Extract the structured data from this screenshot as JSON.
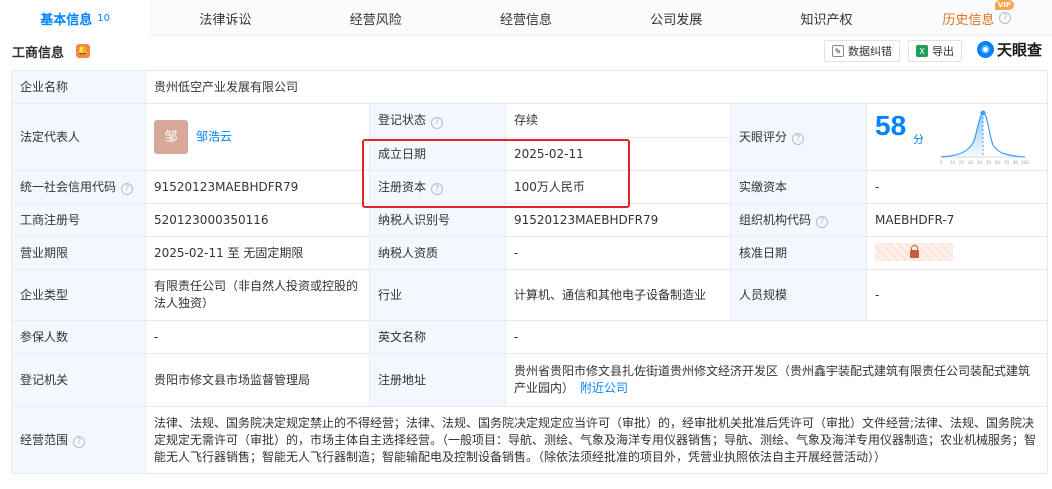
{
  "tabs": [
    {
      "label": "基本信息",
      "count": "10"
    },
    {
      "label": "法律诉讼"
    },
    {
      "label": "经营风险"
    },
    {
      "label": "经营信息"
    },
    {
      "label": "公司发展"
    },
    {
      "label": "知识产权"
    },
    {
      "label": "历史信息",
      "badge": "VIP"
    }
  ],
  "section": {
    "title": "工商信息",
    "correct_button": "数据纠错",
    "export_button": "导出",
    "brand": "天眼查"
  },
  "info": {
    "company_name_label": "企业名称",
    "company_name": "贵州低空产业发展有限公司",
    "legal_rep_label": "法定代表人",
    "legal_rep_avatar": "邹",
    "legal_rep": "邹浩云",
    "reg_status_label": "登记状态",
    "reg_status": "存续",
    "established_label": "成立日期",
    "established": "2025-02-11",
    "reg_capital_label": "注册资本",
    "reg_capital": "100万人民币",
    "score_label": "天眼评分",
    "score": "58",
    "score_unit": "分",
    "credit_code_label": "统一社会信用代码",
    "credit_code": "91520123MAEBHDFR79",
    "paidin_label": "实缴资本",
    "paidin": "-",
    "reg_no_label": "工商注册号",
    "reg_no": "520123000350116",
    "taxpayer_id_label": "纳税人识别号",
    "taxpayer_id": "91520123MAEBHDFR79",
    "org_code_label": "组织机构代码",
    "org_code": "MAEBHDFR-7",
    "term_label": "营业期限",
    "term": "2025-02-11 至 无固定期限",
    "taxpayer_qual_label": "纳税人资质",
    "taxpayer_qual": "-",
    "approval_date_label": "核准日期",
    "type_label": "企业类型",
    "type": "有限责任公司（非自然人投资或控股的法人独资）",
    "industry_label": "行业",
    "industry": "计算机、通信和其他电子设备制造业",
    "staff_label": "人员规模",
    "staff": "-",
    "insured_label": "参保人数",
    "insured": "-",
    "en_name_label": "英文名称",
    "en_name": "-",
    "authority_label": "登记机关",
    "authority": "贵阳市修文县市场监督管理局",
    "address_label": "注册地址",
    "address": "贵州省贵阳市修文县扎佐街道贵州修文经济开发区（贵州鑫宇装配式建筑有限责任公司装配式建筑产业园内）",
    "nearby": "附近公司",
    "scope_label": "经营范围",
    "scope": "法律、法规、国务院决定规定禁止的不得经营；法律、法规、国务院决定规定应当许可（审批）的，经审批机关批准后凭许可（审批）文件经营;法律、法规、国务院决定规定无需许可（审批）的，市场主体自主选择经营。（一般项目：导航、测绘、气象及海洋专用仪器销售；导航、测绘、气象及海洋专用仪器制造；农业机械服务；智能无人飞行器销售；智能无人飞行器制造；智能输配电及控制设备销售。（除依法须经批准的项目外，凭营业执照依法自主开展经营活动））"
  },
  "colors": {
    "accent": "#0084ff",
    "label_bg": "#f2f8fd",
    "status_green": "#11a84c",
    "highlight": "#e8202a",
    "history": "#e1701e"
  }
}
